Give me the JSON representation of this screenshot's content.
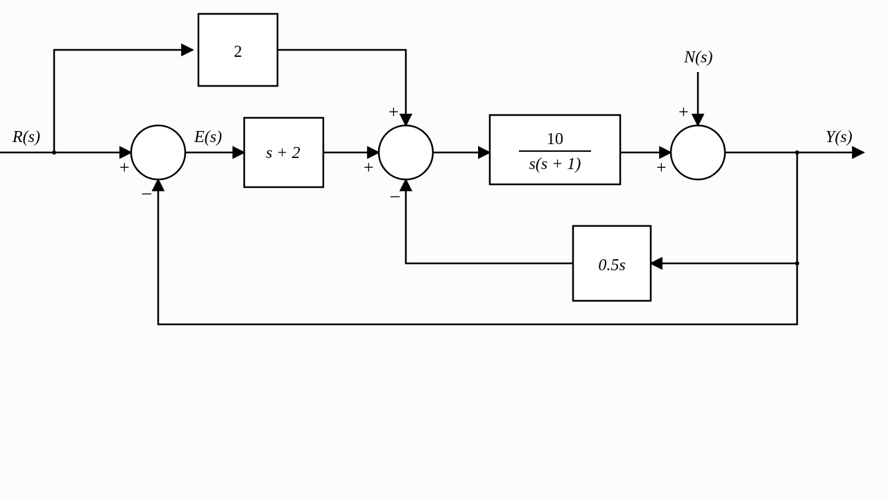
{
  "signals": {
    "input": "R(s)",
    "error": "E(s)",
    "disturbance": "N(s)",
    "output": "Y(s)"
  },
  "blocks": {
    "feedforward": "2",
    "controller": "s + 2",
    "plant_num": "10",
    "plant_den": "s(s + 1)",
    "inner_feedback": "0.5s"
  },
  "signs": {
    "sum1_top": "+",
    "sum1_left": "+",
    "sum1_bot": "–",
    "sum2_top": "+",
    "sum2_left": "+",
    "sum2_bot": "–",
    "sum3_top": "+",
    "sum3_left": "+"
  }
}
